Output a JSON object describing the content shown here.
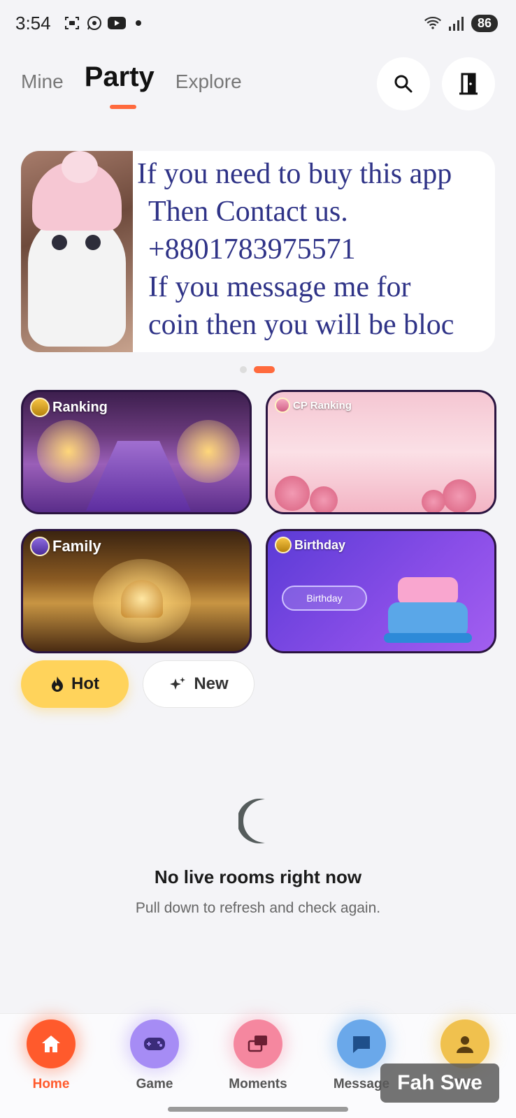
{
  "status_bar": {
    "time": "3:54",
    "battery": "86",
    "icons_left": [
      "screenshot-icon",
      "whatsapp-icon",
      "youtube-icon",
      "notification-dot"
    ],
    "icons_right": [
      "wifi-icon",
      "signal-icon",
      "battery-icon"
    ]
  },
  "top_tabs": {
    "items": [
      {
        "label": "Mine",
        "active": false
      },
      {
        "label": "Party",
        "active": true
      },
      {
        "label": "Explore",
        "active": false
      }
    ],
    "accent": "#ff6a3d"
  },
  "banner": {
    "lines": [
      "If you need to buy this app",
      "Then Contact us.",
      "+8801783975571",
      "If you message me for",
      "coin then you will be bloc"
    ],
    "page_count": 2,
    "active_page": 2
  },
  "feature_cards": [
    {
      "label": "Ranking"
    },
    {
      "label": "CP Ranking"
    },
    {
      "label": "Family"
    },
    {
      "label": "Birthday",
      "button_label": "Birthday"
    }
  ],
  "filters": {
    "hot_label": "Hot",
    "new_label": "New",
    "selected": "Hot"
  },
  "empty_state": {
    "title": "No live rooms right now",
    "subtitle": "Pull down to refresh and check again."
  },
  "bottom_nav": {
    "items": [
      {
        "label": "Home",
        "active": true
      },
      {
        "label": "Game",
        "active": false
      },
      {
        "label": "Moments",
        "active": false
      },
      {
        "label": "Message",
        "active": false
      },
      {
        "label": "Me",
        "active": false
      }
    ]
  },
  "watermark": "Fah Swe"
}
